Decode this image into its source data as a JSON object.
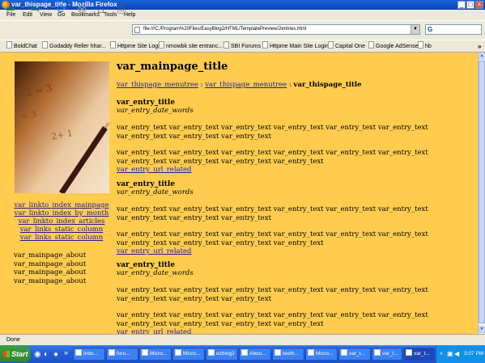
{
  "window": {
    "title": "var_thispage_title - Mozilla Firefox"
  },
  "menu": [
    "File",
    "Edit",
    "View",
    "Go",
    "Bookmarks",
    "Tools",
    "Help"
  ],
  "address": {
    "url": "file:///C:/Program%20Files/EasyBlog2/HTML/TemplatePreview/2entries.html",
    "search_glyph": "G"
  },
  "bookmarks": [
    "BoldChat",
    "Godaddy Reller hhar...",
    "Httpme Site Login",
    "nmowbk site entranc...",
    "SBI Forums",
    "Httpme Main Site Login",
    "Capital One",
    "Google AdSense",
    "hb"
  ],
  "sidebar": {
    "links": [
      "var_linkto_index_mainpage",
      "var_linkto_index_by_month",
      "var_linkto_index_articles",
      "var_links_static_column",
      "var_links_static_column"
    ],
    "about": [
      "var_mainpage_about",
      "var_mainpage_about",
      "var_mainpage_about",
      "var_mainpage_about"
    ]
  },
  "main": {
    "title": "var_mainpage_title",
    "breadcrumb": {
      "link1": "var_thispage_menutree",
      "sep": " : ",
      "link2": "var_thispage_menutree",
      "current": "var_thispage_title"
    }
  },
  "entries": [
    {
      "title": "var_entry_title",
      "date": "var_entry_date_words",
      "para1": "var_entry_text var_entry_text var_entry_text var_entry_text var_entry_text var_entry_text var_entry_text var_entry_text var_entry_text",
      "para2": "var_entry_text var_entry_text var_entry_text var_entry_text var_entry_text var_entry_text var_entry_text var_entry_text var_entry_text var_entry_text",
      "related": "var_entry_url_related"
    },
    {
      "title": "var_entry_title",
      "date": "var_entry_date_words",
      "para1": "var_entry_text var_entry_text var_entry_text var_entry_text var_entry_text var_entry_text var_entry_text var_entry_text var_entry_text",
      "para2": "var_entry_text var_entry_text var_entry_text var_entry_text var_entry_text var_entry_text var_entry_text var_entry_text var_entry_text var_entry_text",
      "related": "var_entry_url_related"
    },
    {
      "title": "var_entry_title",
      "date": "var_entry_date_words",
      "para1": "var_entry_text var_entry_text var_entry_text var_entry_text var_entry_text var_entry_text var_entry_text var_entry_text var_entry_text",
      "para2": "var_entry_text var_entry_text var_entry_text var_entry_text var_entry_text var_entry_text var_entry_text var_entry_text var_entry_text var_entry_text",
      "related": "var_entry_url_related"
    }
  ],
  "status": {
    "text": "Done"
  },
  "taskbar": {
    "start": "Start",
    "tasks": [
      "Inbo...",
      "foru...",
      "Micro...",
      "Micro...",
      "ezblog2",
      "Abou...",
      "teeth...",
      "Micro...",
      "var_t...",
      "var_t...",
      "var_t..."
    ],
    "clock": "3:07 PM"
  },
  "colors": {
    "page_bg": "#ffcc4e",
    "link": "#1c1ca0",
    "titlebar": "#0a43b8"
  }
}
